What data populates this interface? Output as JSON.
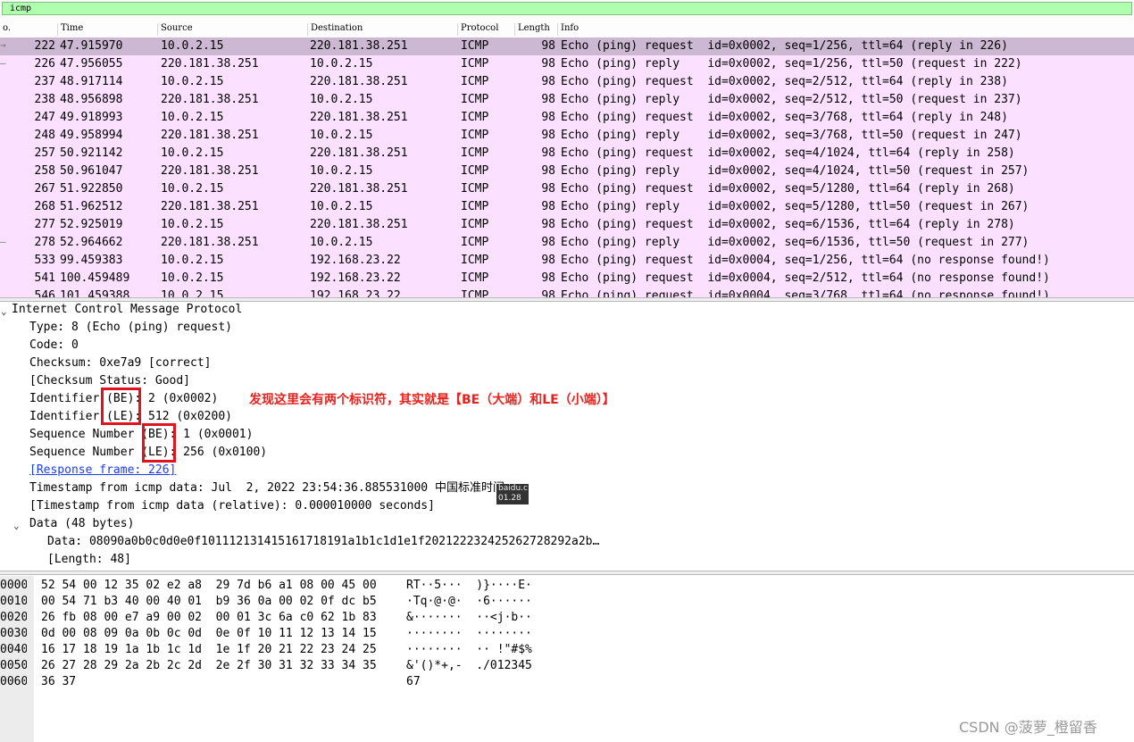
{
  "filter": {
    "value": "icmp"
  },
  "columns": [
    "o.",
    "Time",
    "Source",
    "Destination",
    "Protocol",
    "Length",
    "Info"
  ],
  "packets": [
    {
      "no": "222",
      "time": "47.915970",
      "src": "10.0.2.15",
      "dst": "220.181.38.251",
      "proto": "ICMP",
      "len": "98",
      "info": "Echo (ping) request  id=0x0002, seq=1/256, ttl=64 (reply in 226)",
      "mark": "→"
    },
    {
      "no": "226",
      "time": "47.956055",
      "src": "220.181.38.251",
      "dst": "10.0.2.15",
      "proto": "ICMP",
      "len": "98",
      "info": "Echo (ping) reply    id=0x0002, seq=1/256, ttl=50 (request in 222)",
      "mark": "—"
    },
    {
      "no": "237",
      "time": "48.917114",
      "src": "10.0.2.15",
      "dst": "220.181.38.251",
      "proto": "ICMP",
      "len": "98",
      "info": "Echo (ping) request  id=0x0002, seq=2/512, ttl=64 (reply in 238)",
      "mark": ""
    },
    {
      "no": "238",
      "time": "48.956898",
      "src": "220.181.38.251",
      "dst": "10.0.2.15",
      "proto": "ICMP",
      "len": "98",
      "info": "Echo (ping) reply    id=0x0002, seq=2/512, ttl=50 (request in 237)",
      "mark": ""
    },
    {
      "no": "247",
      "time": "49.918993",
      "src": "10.0.2.15",
      "dst": "220.181.38.251",
      "proto": "ICMP",
      "len": "98",
      "info": "Echo (ping) request  id=0x0002, seq=3/768, ttl=64 (reply in 248)",
      "mark": ""
    },
    {
      "no": "248",
      "time": "49.958994",
      "src": "220.181.38.251",
      "dst": "10.0.2.15",
      "proto": "ICMP",
      "len": "98",
      "info": "Echo (ping) reply    id=0x0002, seq=3/768, ttl=50 (request in 247)",
      "mark": ""
    },
    {
      "no": "257",
      "time": "50.921142",
      "src": "10.0.2.15",
      "dst": "220.181.38.251",
      "proto": "ICMP",
      "len": "98",
      "info": "Echo (ping) request  id=0x0002, seq=4/1024, ttl=64 (reply in 258)",
      "mark": ""
    },
    {
      "no": "258",
      "time": "50.961047",
      "src": "220.181.38.251",
      "dst": "10.0.2.15",
      "proto": "ICMP",
      "len": "98",
      "info": "Echo (ping) reply    id=0x0002, seq=4/1024, ttl=50 (request in 257)",
      "mark": ""
    },
    {
      "no": "267",
      "time": "51.922850",
      "src": "10.0.2.15",
      "dst": "220.181.38.251",
      "proto": "ICMP",
      "len": "98",
      "info": "Echo (ping) request  id=0x0002, seq=5/1280, ttl=64 (reply in 268)",
      "mark": ""
    },
    {
      "no": "268",
      "time": "51.962512",
      "src": "220.181.38.251",
      "dst": "10.0.2.15",
      "proto": "ICMP",
      "len": "98",
      "info": "Echo (ping) reply    id=0x0002, seq=5/1280, ttl=50 (request in 267)",
      "mark": ""
    },
    {
      "no": "277",
      "time": "52.925019",
      "src": "10.0.2.15",
      "dst": "220.181.38.251",
      "proto": "ICMP",
      "len": "98",
      "info": "Echo (ping) request  id=0x0002, seq=6/1536, ttl=64 (reply in 278)",
      "mark": ""
    },
    {
      "no": "278",
      "time": "52.964662",
      "src": "220.181.38.251",
      "dst": "10.0.2.15",
      "proto": "ICMP",
      "len": "98",
      "info": "Echo (ping) reply    id=0x0002, seq=6/1536, ttl=50 (request in 277)",
      "mark": "—"
    },
    {
      "no": "533",
      "time": "99.459383",
      "src": "10.0.2.15",
      "dst": "192.168.23.22",
      "proto": "ICMP",
      "len": "98",
      "info": "Echo (ping) request  id=0x0004, seq=1/256, ttl=64 (no response found!)",
      "mark": ""
    },
    {
      "no": "541",
      "time": "100.459489",
      "src": "10.0.2.15",
      "dst": "192.168.23.22",
      "proto": "ICMP",
      "len": "98",
      "info": "Echo (ping) request  id=0x0004, seq=2/512, ttl=64 (no response found!)",
      "mark": ""
    },
    {
      "no": "546",
      "time": "101.459388",
      "src": "10.0.2.15",
      "dst": "192.168.23.22",
      "proto": "ICMP",
      "len": "98",
      "info": "Echo (ping) request  id=0x0004, seq=3/768, ttl=64 (no response found!)",
      "mark": ""
    }
  ],
  "details": {
    "protocol": "Internet Control Message Protocol",
    "type": "Type: 8 (Echo (ping) request)",
    "code": "Code: 0",
    "checksum": "Checksum: 0xe7a9 [correct]",
    "checksum_status": "[Checksum Status: Good]",
    "id_be": "Identifier (BE): 2 (0x0002)",
    "id_le": "Identifier (LE): 512 (0x0200)",
    "seq_be": "Sequence Number (BE): 1 (0x0001)",
    "seq_le": "Sequence Number (LE): 256 (0x0100)",
    "response_frame": "[Response frame: 226]",
    "timestamp": "Timestamp from icmp data: Jul  2, 2022 23:54:36.885531000 中国标准时间",
    "timestamp_rel": "[Timestamp from icmp data (relative): 0.000010000 seconds]",
    "data": "Data (48 bytes)",
    "data_value": "Data: 08090a0b0c0d0e0f101112131415161718191a1b1c1d1e1f202122232425262728292a2b…",
    "data_length": "[Length: 48]"
  },
  "annotation": "发现这里会有两个标识符，其实就是【BE（大端）和LE（小端）】",
  "tooltip": {
    "line1": "baidu.c",
    "line2": "01.28"
  },
  "bytes": [
    {
      "off": "0000",
      "hex": "52 54 00 12 35 02 e2 a8  29 7d b6 a1 08 00 45 00",
      "ascii": "RT··5···  )}····E·"
    },
    {
      "off": "0010",
      "hex": "00 54 71 b3 40 00 40 01  b9 36 0a 00 02 0f dc b5",
      "ascii": "·Tq·@·@·  ·6······"
    },
    {
      "off": "0020",
      "hex": "26 fb 08 00 e7 a9 00 02  00 01 3c 6a c0 62 1b 83",
      "ascii": "&·······  ··<j·b··"
    },
    {
      "off": "0030",
      "hex": "0d 00 08 09 0a 0b 0c 0d  0e 0f 10 11 12 13 14 15",
      "ascii": "········  ········"
    },
    {
      "off": "0040",
      "hex": "16 17 18 19 1a 1b 1c 1d  1e 1f 20 21 22 23 24 25",
      "ascii": "········  ·· !\"#$%"
    },
    {
      "off": "0050",
      "hex": "26 27 28 29 2a 2b 2c 2d  2e 2f 30 31 32 33 34 35",
      "ascii": "&'()*+,-  ./012345"
    },
    {
      "off": "0060",
      "hex": "36 37",
      "ascii": "67"
    }
  ],
  "watermark": "CSDN @菠萝_橙留香",
  "colors": {
    "row_bg": "#fce0ff",
    "row_selected": "#cdb8d3",
    "filter_bg": "#afffaf",
    "annotation": "#e8231f"
  }
}
